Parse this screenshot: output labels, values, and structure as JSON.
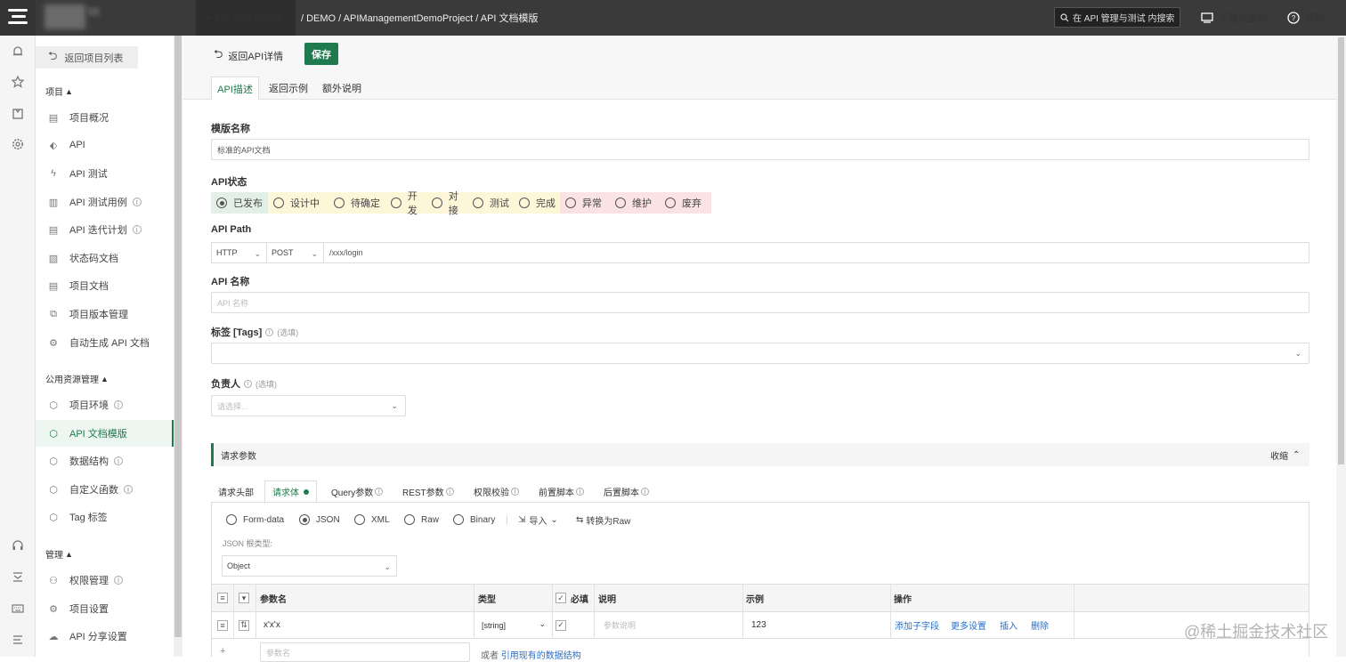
{
  "topbar": {
    "module": "API 管理与测试",
    "breadcrumb": "/ DEMO / APIManagementDemoProject / API 文档模版",
    "search_placeholder": "在 API 管理与测试 内搜索",
    "download": "下载桌面端",
    "help": "帮助"
  },
  "sidebar": {
    "back": "返回项目列表",
    "sections": [
      {
        "title": "项目",
        "items": [
          "项目概况",
          "API",
          "API 测试",
          "API 测试用例",
          "API 迭代计划",
          "状态码文档",
          "项目文档",
          "项目版本管理",
          "自动生成 API 文档"
        ]
      },
      {
        "title": "公用资源管理",
        "items": [
          "项目环境",
          "API 文档模版",
          "数据结构",
          "自定义函数",
          "Tag 标签"
        ]
      },
      {
        "title": "管理",
        "items": [
          "权限管理",
          "项目设置",
          "API 分享设置"
        ]
      }
    ],
    "active": "API 文档模版"
  },
  "toolbar": {
    "back": "返回API详情",
    "save": "保存"
  },
  "tabs": [
    "API描述",
    "返回示例",
    "额外说明"
  ],
  "form": {
    "template_name_label": "模版名称",
    "template_name_value": "标准的API文档",
    "status_label": "API状态",
    "statuses": [
      {
        "label": "已发布",
        "selected": true,
        "bg": "#e3f0e8"
      },
      {
        "label": "设计中",
        "selected": false,
        "bg": "#fdf6d9"
      },
      {
        "label": "待确定",
        "selected": false,
        "bg": "#fdf6d9"
      },
      {
        "label": "开发",
        "selected": false,
        "bg": "#fdf6d9"
      },
      {
        "label": "对接",
        "selected": false,
        "bg": "#fdf6d9"
      },
      {
        "label": "测试",
        "selected": false,
        "bg": "#fdf6d9"
      },
      {
        "label": "完成",
        "selected": false,
        "bg": "#fdf6d9"
      },
      {
        "label": "异常",
        "selected": false,
        "bg": "#fbe3e3"
      },
      {
        "label": "维护",
        "selected": false,
        "bg": "#fbe3e3"
      },
      {
        "label": "废弃",
        "selected": false,
        "bg": "#fbe3e3"
      }
    ],
    "path_label": "API Path",
    "protocol": "HTTP",
    "method": "POST",
    "path_value": "/xxx/login",
    "name_label": "API 名称",
    "name_placeholder": "API 名称",
    "tags_label": "标签 [Tags]",
    "tags_opt": "(选填)",
    "owner_label": "负责人",
    "owner_opt": "(选填)",
    "owner_placeholder": "请选择..."
  },
  "request": {
    "header": "请求参数",
    "collapse": "收缩",
    "subtabs": [
      "请求头部",
      "请求体",
      "Query参数",
      "REST参数",
      "权限校验",
      "前置脚本",
      "后置脚本"
    ],
    "body_types": [
      "Form-data",
      "JSON",
      "XML",
      "Raw",
      "Binary"
    ],
    "body_selected": "JSON",
    "import": "导入",
    "convert": "转换为Raw",
    "json_root_label": "JSON 根类型:",
    "json_root_value": "Object",
    "columns": {
      "name": "参数名",
      "type": "类型",
      "required": "必填",
      "desc": "说明",
      "example": "示例",
      "ops": "操作"
    },
    "row": {
      "name": "x'x'x",
      "type": "[string]",
      "desc_placeholder": "参数说明",
      "example": "123",
      "actions": [
        "添加子字段",
        "更多设置",
        "插入",
        "删除"
      ]
    },
    "new_name_placeholder": "参数名",
    "or_text": "或者",
    "ref_link": "引用现有的数据结构"
  },
  "watermark": "@稀土掘金技术社区",
  "colors": {
    "accent": "#1f7a4d",
    "topbar": "#3a3a3a",
    "link": "#2a6fc9"
  }
}
